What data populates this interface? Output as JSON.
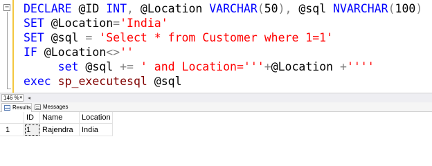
{
  "editor": {
    "lines": [
      [
        {
          "t": "DECLARE",
          "c": "kw"
        },
        {
          "t": " @ID ",
          "c": "var"
        },
        {
          "t": "INT",
          "c": "kw"
        },
        {
          "t": ", ",
          "c": "op"
        },
        {
          "t": "@Location ",
          "c": "var"
        },
        {
          "t": "VARCHAR",
          "c": "kw"
        },
        {
          "t": "(",
          "c": "op"
        },
        {
          "t": "50",
          "c": "var"
        },
        {
          "t": "), ",
          "c": "op"
        },
        {
          "t": "@sql ",
          "c": "var"
        },
        {
          "t": "NVARCHAR",
          "c": "kw"
        },
        {
          "t": "(",
          "c": "op"
        },
        {
          "t": "100",
          "c": "var"
        },
        {
          "t": ")",
          "c": "op"
        }
      ],
      [
        {
          "t": "SET",
          "c": "kw"
        },
        {
          "t": " @Location",
          "c": "var"
        },
        {
          "t": "=",
          "c": "op"
        },
        {
          "t": "'India'",
          "c": "str"
        }
      ],
      [
        {
          "t": "SET",
          "c": "kw"
        },
        {
          "t": " @sql ",
          "c": "var"
        },
        {
          "t": "=",
          "c": "op"
        },
        {
          "t": " 'Select * from Customer where 1=1'",
          "c": "str"
        }
      ],
      [
        {
          "t": "IF",
          "c": "kw"
        },
        {
          "t": " @Location",
          "c": "var"
        },
        {
          "t": "<>",
          "c": "op"
        },
        {
          "t": "''",
          "c": "str"
        }
      ],
      [
        {
          "t": "     ",
          "c": "var"
        },
        {
          "t": "set",
          "c": "kw"
        },
        {
          "t": " @sql ",
          "c": "var"
        },
        {
          "t": "+=",
          "c": "op"
        },
        {
          "t": " ' and Location='''",
          "c": "str"
        },
        {
          "t": "+",
          "c": "op"
        },
        {
          "t": "@Location ",
          "c": "var"
        },
        {
          "t": "+",
          "c": "op"
        },
        {
          "t": "''''",
          "c": "str"
        }
      ],
      [
        {
          "t": "exec",
          "c": "kw"
        },
        {
          "t": " sp_executesql",
          "c": "fn"
        },
        {
          "t": " @sql",
          "c": "var"
        }
      ]
    ]
  },
  "zoom": {
    "level": "146 %"
  },
  "results_tabs": [
    {
      "label": "Results",
      "icon": "grid-icon",
      "active": true
    },
    {
      "label": "Messages",
      "icon": "messages-icon",
      "active": false
    }
  ],
  "grid": {
    "columns": [
      "ID",
      "Name",
      "Location"
    ],
    "rows": [
      {
        "num": "1",
        "cells": [
          "1",
          "Rajendra",
          "India"
        ]
      }
    ]
  }
}
